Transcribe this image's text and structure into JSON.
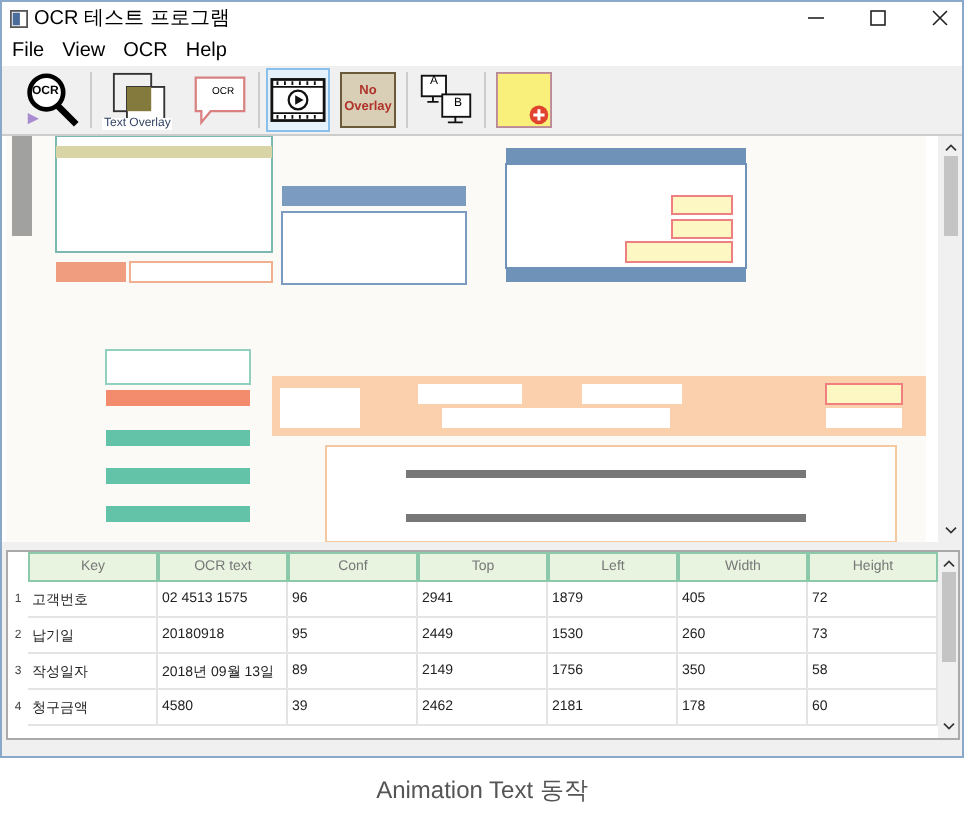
{
  "window": {
    "title": "OCR 테스트 프로그램"
  },
  "menu": [
    "File",
    "View",
    "OCR",
    "Help"
  ],
  "toolbar": [
    {
      "kind": "ocr",
      "label": "OCR",
      "selected": false
    },
    {
      "kind": "overlay",
      "label": "Text Overlay",
      "selected": false
    },
    {
      "kind": "bubble",
      "label": "OCR",
      "selected": false
    },
    {
      "kind": "video",
      "selected": true
    },
    {
      "kind": "text",
      "label": "No Overlay",
      "selected": false
    },
    {
      "kind": "monitors",
      "label": "A",
      "label2": "B",
      "selected": false
    },
    {
      "kind": "note",
      "selected": false
    }
  ],
  "table": {
    "columns": [
      "Key",
      "OCR text",
      "Conf",
      "Top",
      "Left",
      "Width",
      "Height"
    ],
    "rows": [
      {
        "number": "1",
        "cells": [
          "고객번호",
          "02 4513 1575",
          "96",
          "2941",
          "1879",
          "405",
          "72"
        ]
      },
      {
        "number": "2",
        "cells": [
          "납기일",
          "20180918",
          "95",
          "2449",
          "1530",
          "260",
          "73"
        ]
      },
      {
        "number": "3",
        "cells": [
          "작성일자",
          "2018년 09월 13일",
          "89",
          "2149",
          "1756",
          "350",
          "58"
        ]
      },
      {
        "number": "4",
        "cells": [
          "청구금액",
          "4580",
          "39",
          "2462",
          "2181",
          "178",
          "60"
        ]
      }
    ]
  },
  "caption": "Animation Text 동작"
}
